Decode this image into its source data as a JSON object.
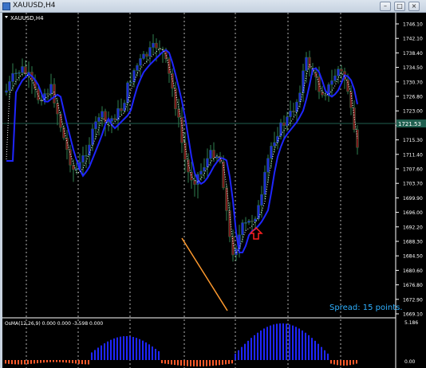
{
  "window": {
    "title": "XAUUSD,H4",
    "minimize_glyph": "–",
    "restore_glyph": "□",
    "close_glyph": "×"
  },
  "chart": {
    "symbol_label": "XAUUSD,H4",
    "current_price_label": "1721.53",
    "spread_text": "Spread: 15 points.",
    "indicator_label": "OsMA(12,26,9) 0.000 0.000 -3.598 0.000",
    "indicator_top_value": "5.186",
    "indicator_bottom_value": "0.00",
    "price_ticks": [
      "1746.10",
      "1742.10",
      "1738.40",
      "1734.50",
      "1730.70",
      "1726.80",
      "1723.00",
      "1719.10",
      "1715.30",
      "1711.40",
      "1707.60",
      "1703.70",
      "1699.90",
      "1696.00",
      "1692.20",
      "1688.30",
      "1684.50",
      "1680.60",
      "1676.80",
      "1672.90",
      "1669.10"
    ],
    "colors": {
      "background": "#000000",
      "bull_body": "#1e2bd6",
      "bear_body": "#7a1c1c",
      "wick": "#2f7f4f",
      "ma": "#1f26ff",
      "dotted_ma": "#ffffff",
      "trendline": "#ff9a2e",
      "arrow": "#ff2020",
      "price_line": "#1f5f4f",
      "spread_text": "#2fb0ff",
      "osma_pos": "#1f26ff",
      "osma_neg": "#ff5a2a"
    }
  }
}
